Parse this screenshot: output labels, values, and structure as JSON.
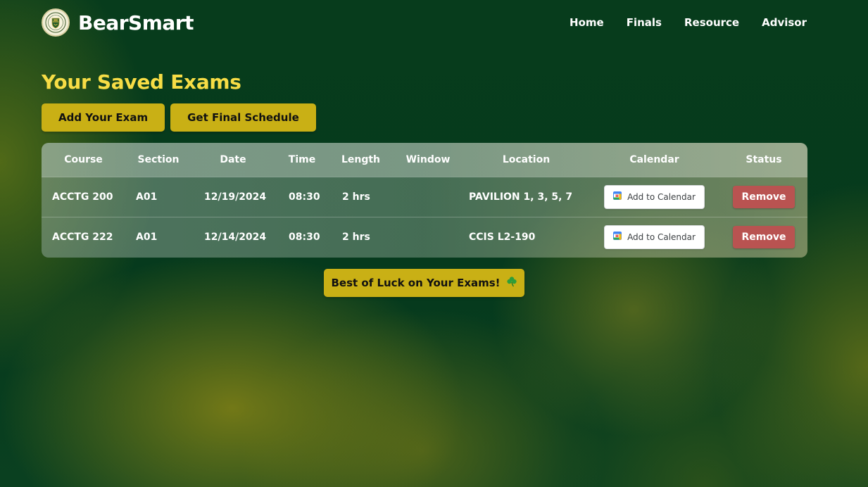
{
  "colors": {
    "accent_gold": "#c9b015",
    "title_yellow": "#f7dd45",
    "remove_red": "#b95351",
    "background_green": "#063a1c"
  },
  "header": {
    "brand": "BearSmart",
    "logo_icon": "university-crest-icon",
    "nav": [
      {
        "label": "Home"
      },
      {
        "label": "Finals"
      },
      {
        "label": "Resource"
      },
      {
        "label": "Advisor"
      }
    ]
  },
  "main": {
    "title": "Your Saved Exams",
    "add_exam_label": "Add Your Exam",
    "get_schedule_label": "Get Final Schedule",
    "luck_message": "Best of Luck on Your Exams!",
    "luck_icon": "shamrock-icon"
  },
  "table": {
    "columns": [
      "Course",
      "Section",
      "Date",
      "Time",
      "Length",
      "Window",
      "Location",
      "Calendar",
      "Status"
    ],
    "rows": [
      {
        "course": "ACCTG 200",
        "section": "A01",
        "date": "12/19/2024",
        "time": "08:30",
        "length": "2 hrs",
        "window": "",
        "location": "PAVILION 1, 3, 5, 7",
        "calendar_label": "Add to Calendar",
        "status_label": "Remove"
      },
      {
        "course": "ACCTG 222",
        "section": "A01",
        "date": "12/14/2024",
        "time": "08:30",
        "length": "2 hrs",
        "window": "",
        "location": "CCIS L2-190",
        "calendar_label": "Add to Calendar",
        "status_label": "Remove"
      }
    ]
  }
}
